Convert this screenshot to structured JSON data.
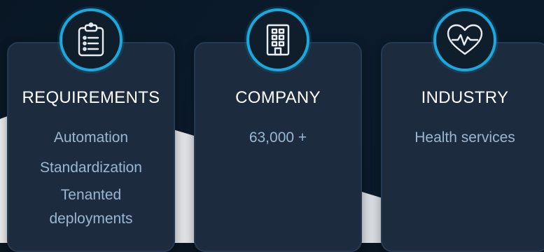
{
  "colors": {
    "accent": "#1aa9de",
    "card_background": "#1c2b3d",
    "title_text": "#ffffff",
    "item_text": "#9bb7d2"
  },
  "cards": [
    {
      "icon": "clipboard-icon",
      "title": "REQUIREMENTS",
      "items": [
        "Automation",
        "Standardization",
        "Tenanted deployments"
      ]
    },
    {
      "icon": "building-icon",
      "title": "COMPANY",
      "items": [
        "63,000 +"
      ]
    },
    {
      "icon": "heart-pulse-icon",
      "title": "INDUSTRY",
      "items": [
        "Health services"
      ]
    }
  ]
}
